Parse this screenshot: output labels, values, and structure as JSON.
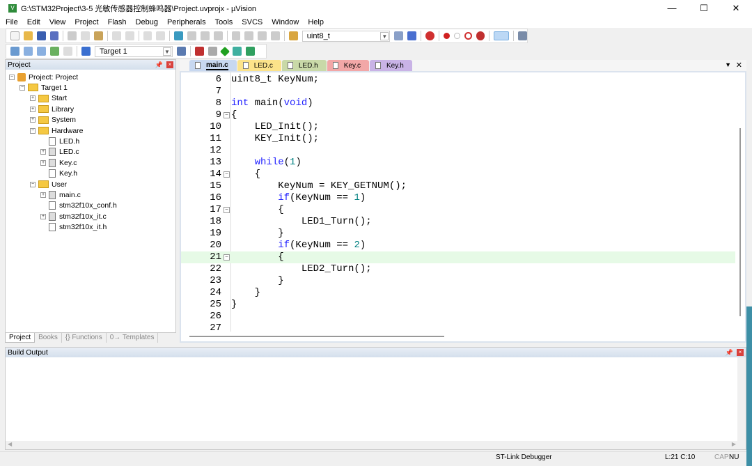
{
  "window": {
    "title": "G:\\STM32Project\\3-5 光敏传感器控制蜂鸣器\\Project.uvprojx - µVision",
    "app_icon": "µVision-icon",
    "controls": [
      "—",
      "☐",
      "✕"
    ]
  },
  "menu": [
    "File",
    "Edit",
    "View",
    "Project",
    "Flash",
    "Debug",
    "Peripherals",
    "Tools",
    "SVCS",
    "Window",
    "Help"
  ],
  "toolbar": {
    "find_combo": "uint8_t",
    "target_combo": "Target 1"
  },
  "project_panel": {
    "title": "Project",
    "tree": [
      {
        "label": "Project: Project",
        "level": 0,
        "type": "root",
        "expander": "−"
      },
      {
        "label": "Target 1",
        "level": 1,
        "type": "target",
        "expander": "−"
      },
      {
        "label": "Start",
        "level": 2,
        "type": "folder",
        "expander": "+"
      },
      {
        "label": "Library",
        "level": 2,
        "type": "folder",
        "expander": "+"
      },
      {
        "label": "System",
        "level": 2,
        "type": "folder",
        "expander": "+"
      },
      {
        "label": "Hardware",
        "level": 2,
        "type": "folder-open",
        "expander": "−"
      },
      {
        "label": "LED.h",
        "level": 3,
        "type": "file",
        "expander": ""
      },
      {
        "label": "LED.c",
        "level": 3,
        "type": "file-c",
        "expander": "+"
      },
      {
        "label": "Key.c",
        "level": 3,
        "type": "file-c",
        "expander": "+"
      },
      {
        "label": "Key.h",
        "level": 3,
        "type": "file",
        "expander": ""
      },
      {
        "label": "User",
        "level": 2,
        "type": "folder-open",
        "expander": "−"
      },
      {
        "label": "main.c",
        "level": 3,
        "type": "file-c",
        "expander": "+"
      },
      {
        "label": "stm32f10x_conf.h",
        "level": 3,
        "type": "file",
        "expander": ""
      },
      {
        "label": "stm32f10x_it.c",
        "level": 3,
        "type": "file-c",
        "expander": "+"
      },
      {
        "label": "stm32f10x_it.h",
        "level": 3,
        "type": "file",
        "expander": ""
      }
    ],
    "tabs": [
      "Project",
      "Books",
      "{} Functions",
      "0→ Templates"
    ]
  },
  "editor": {
    "tabs": [
      {
        "label": "main.c",
        "color": "#c8d8f0",
        "active": true
      },
      {
        "label": "LED.c",
        "color": "#fce38a"
      },
      {
        "label": "LED.h",
        "color": "#c9d9a8"
      },
      {
        "label": "Key.c",
        "color": "#f2a7a7"
      },
      {
        "label": "Key.h",
        "color": "#c9b3e6"
      }
    ],
    "current_line": 21,
    "lines": [
      {
        "n": "6",
        "t": [
          [
            "uint8_t KeyNum;",
            ""
          ]
        ]
      },
      {
        "n": "7",
        "t": []
      },
      {
        "n": "8",
        "t": [
          [
            "int",
            "kw"
          ],
          [
            " main(",
            ""
          ],
          [
            "void",
            "kw"
          ],
          [
            ")",
            ""
          ]
        ]
      },
      {
        "n": "9",
        "fold": true,
        "t": [
          [
            "{",
            ""
          ]
        ]
      },
      {
        "n": "10",
        "t": [
          [
            "    LED_Init();",
            ""
          ]
        ]
      },
      {
        "n": "11",
        "t": [
          [
            "    KEY_Init();",
            ""
          ]
        ]
      },
      {
        "n": "12",
        "t": []
      },
      {
        "n": "13",
        "t": [
          [
            "    ",
            ""
          ],
          [
            "while",
            "kw"
          ],
          [
            "(",
            ""
          ],
          [
            "1",
            "num"
          ],
          [
            ")",
            ""
          ]
        ]
      },
      {
        "n": "14",
        "fold": true,
        "t": [
          [
            "    {",
            ""
          ]
        ]
      },
      {
        "n": "15",
        "t": [
          [
            "        KeyNum = KEY_GETNUM();",
            ""
          ]
        ]
      },
      {
        "n": "16",
        "t": [
          [
            "        ",
            ""
          ],
          [
            "if",
            "kw"
          ],
          [
            "(KeyNum == ",
            ""
          ],
          [
            "1",
            "num"
          ],
          [
            ")",
            ""
          ]
        ]
      },
      {
        "n": "17",
        "fold": true,
        "t": [
          [
            "        {",
            ""
          ]
        ]
      },
      {
        "n": "18",
        "t": [
          [
            "            LED1_Turn();",
            ""
          ]
        ]
      },
      {
        "n": "19",
        "t": [
          [
            "        }",
            ""
          ]
        ]
      },
      {
        "n": "20",
        "t": [
          [
            "        ",
            ""
          ],
          [
            "if",
            "kw"
          ],
          [
            "(KeyNum == ",
            ""
          ],
          [
            "2",
            "num"
          ],
          [
            ")",
            ""
          ]
        ]
      },
      {
        "n": "21",
        "fold": true,
        "t": [
          [
            "        {",
            ""
          ]
        ]
      },
      {
        "n": "22",
        "t": [
          [
            "            LED2_Turn();",
            ""
          ]
        ]
      },
      {
        "n": "23",
        "t": [
          [
            "        }",
            ""
          ]
        ]
      },
      {
        "n": "24",
        "t": [
          [
            "    }",
            ""
          ]
        ]
      },
      {
        "n": "25",
        "t": [
          [
            "}",
            ""
          ]
        ]
      },
      {
        "n": "26",
        "t": []
      },
      {
        "n": "27",
        "t": []
      }
    ]
  },
  "build_output": {
    "title": "Build Output",
    "content": ""
  },
  "status": {
    "debugger": "ST-Link Debugger",
    "position": "L:21 C:10",
    "cap": "CAP",
    "num": "NU"
  }
}
